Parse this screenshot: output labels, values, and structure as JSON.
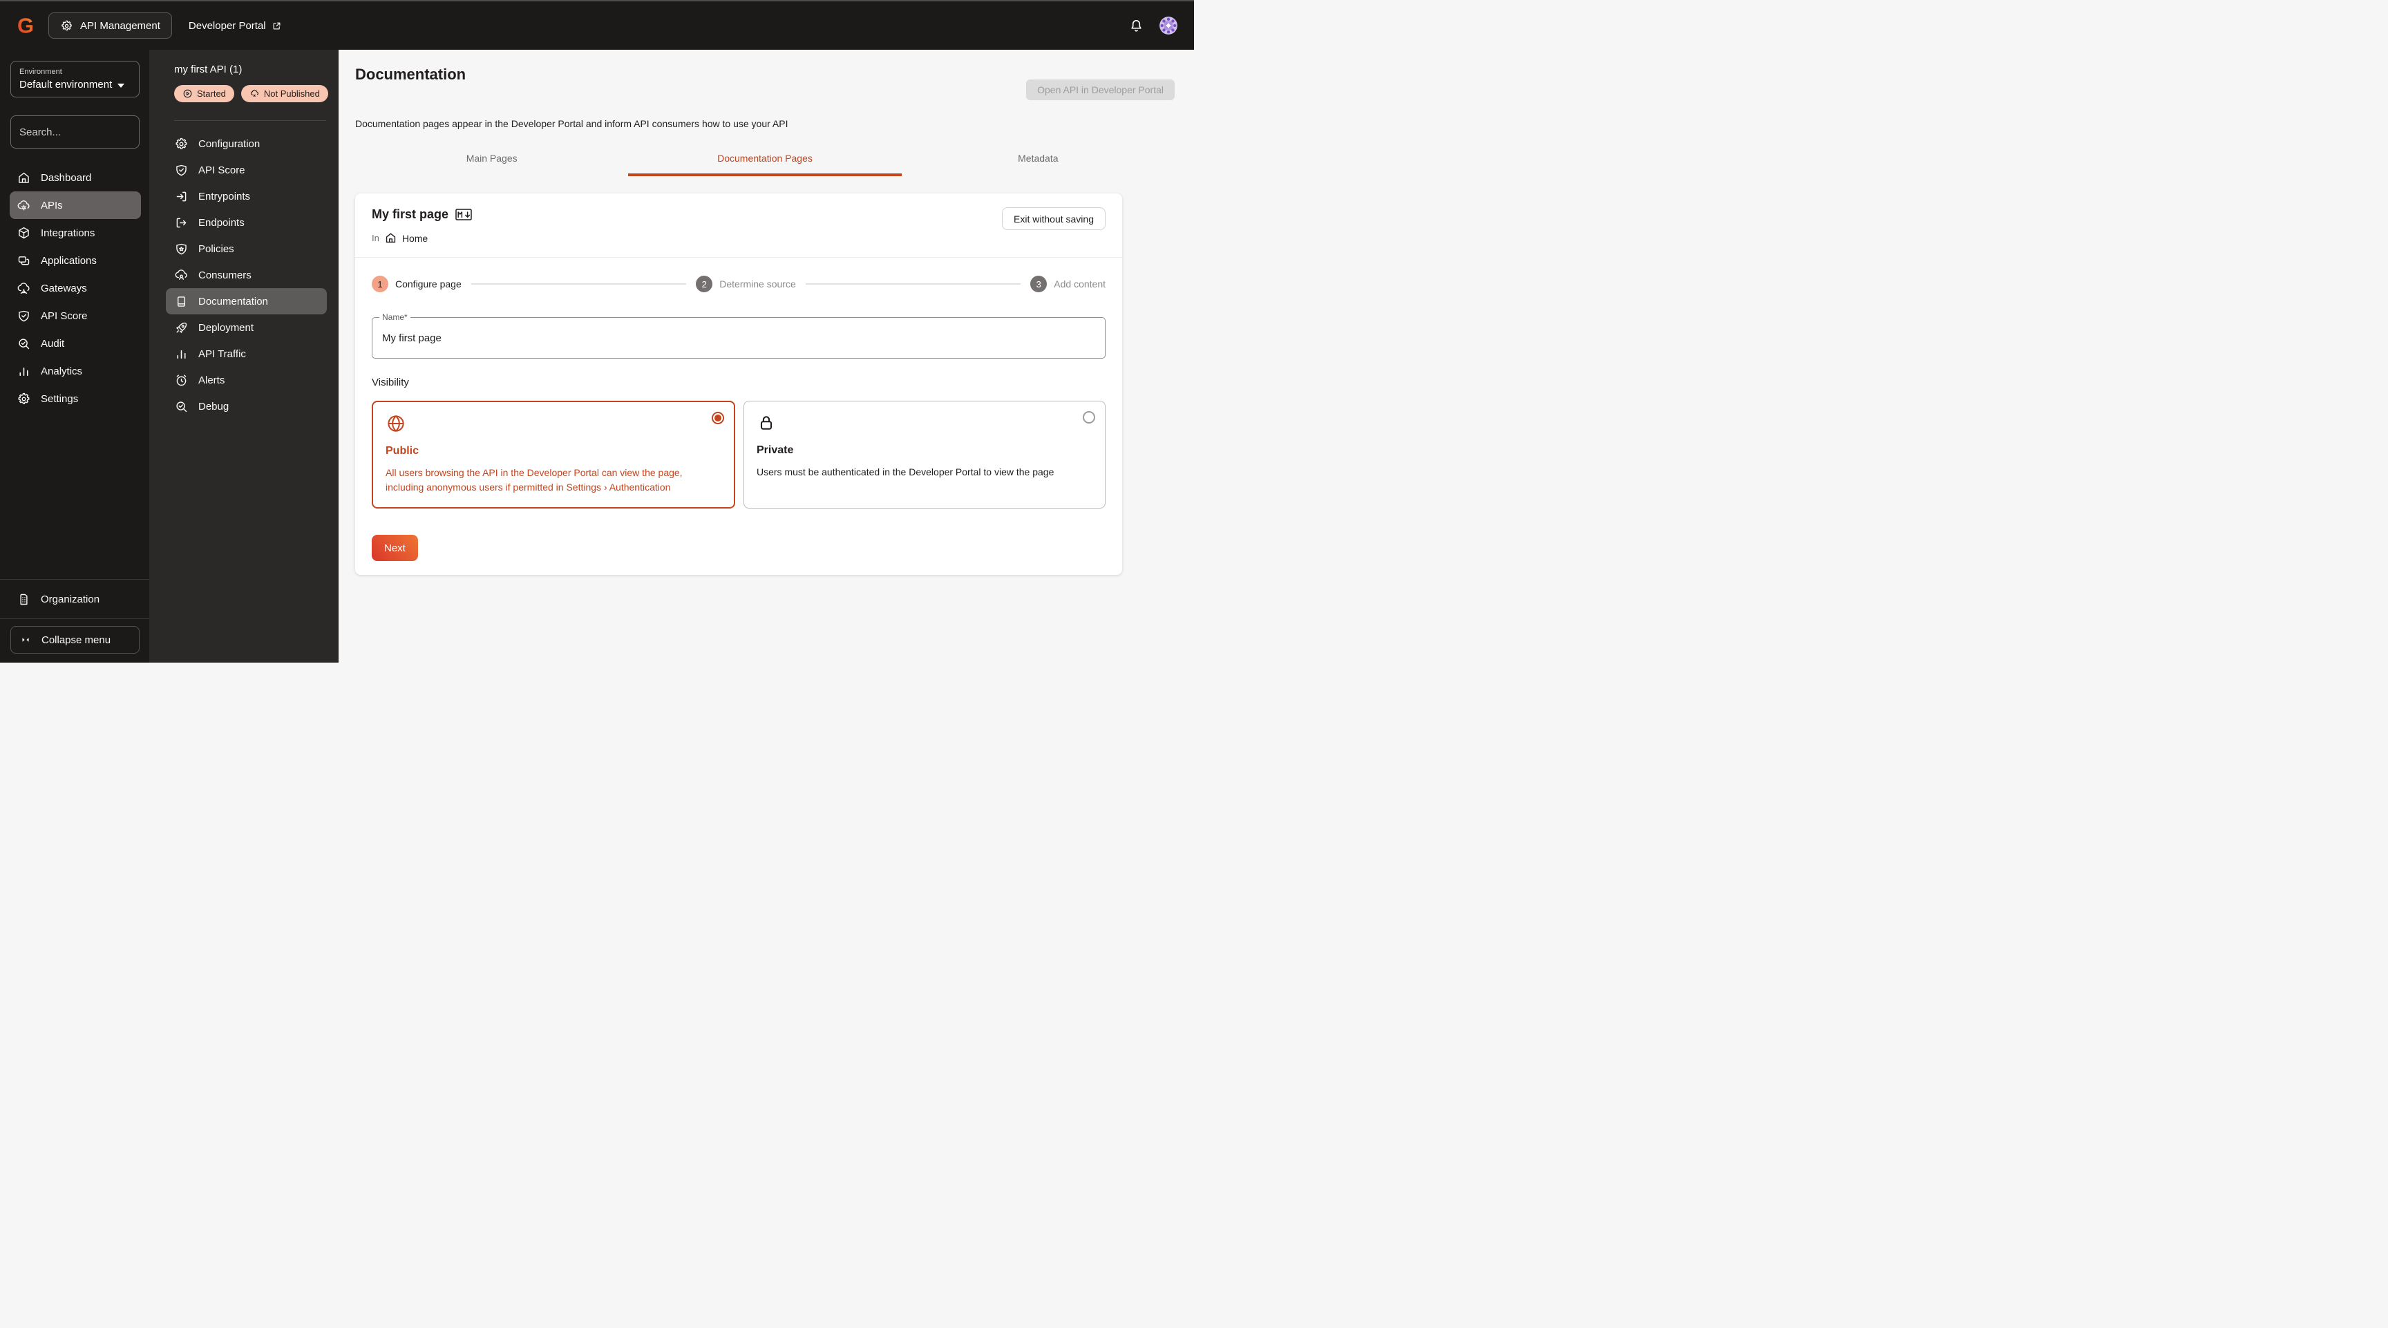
{
  "topbar": {
    "app_switcher": "API Management",
    "portal_link": "Developer Portal"
  },
  "sidebar": {
    "environment_label": "Environment",
    "environment_value": "Default environment",
    "search_placeholder": "Search...",
    "items": [
      {
        "label": "Dashboard",
        "icon": "home-icon"
      },
      {
        "label": "APIs",
        "icon": "cloud-gear-icon",
        "selected": true
      },
      {
        "label": "Integrations",
        "icon": "cube-icon"
      },
      {
        "label": "Applications",
        "icon": "cards-icon"
      },
      {
        "label": "Gateways",
        "icon": "cloud-node-icon"
      },
      {
        "label": "API Score",
        "icon": "shield-check-icon"
      },
      {
        "label": "Audit",
        "icon": "magnifier-check-icon"
      },
      {
        "label": "Analytics",
        "icon": "bar-chart-icon"
      },
      {
        "label": "Settings",
        "icon": "gear-icon"
      }
    ],
    "organization_label": "Organization",
    "collapse_label": "Collapse menu"
  },
  "api_menu": {
    "title": "my first API (1)",
    "badges": [
      {
        "label": "Started",
        "icon": "play-circle-icon"
      },
      {
        "label": "Not Published",
        "icon": "cloud-x-icon"
      }
    ],
    "items": [
      {
        "label": "Configuration",
        "icon": "gear-icon"
      },
      {
        "label": "API Score",
        "icon": "shield-check-icon"
      },
      {
        "label": "Entrypoints",
        "icon": "sign-in-icon"
      },
      {
        "label": "Endpoints",
        "icon": "sign-out-icon"
      },
      {
        "label": "Policies",
        "icon": "shield-star-icon"
      },
      {
        "label": "Consumers",
        "icon": "cloud-person-icon"
      },
      {
        "label": "Documentation",
        "icon": "book-icon",
        "selected": true
      },
      {
        "label": "Deployment",
        "icon": "rocket-icon"
      },
      {
        "label": "API Traffic",
        "icon": "bar-chart-icon"
      },
      {
        "label": "Alerts",
        "icon": "alarm-clock-icon"
      },
      {
        "label": "Debug",
        "icon": "magnifier-check-icon"
      }
    ]
  },
  "main": {
    "title": "Documentation",
    "description": "Documentation pages appear in the Developer Portal and inform API consumers how to use your API",
    "open_api_button": "Open API in Developer Portal",
    "tabs": [
      {
        "label": "Main Pages"
      },
      {
        "label": "Documentation Pages",
        "active": true
      },
      {
        "label": "Metadata"
      }
    ],
    "editor": {
      "page_title": "My first page",
      "format_icon": "markdown-icon",
      "location_prefix": "In",
      "location": "Home",
      "exit_button": "Exit without saving",
      "steps": [
        {
          "number": "1",
          "label": "Configure page",
          "state": "active"
        },
        {
          "number": "2",
          "label": "Determine source",
          "state": "inactive"
        },
        {
          "number": "3",
          "label": "Add content",
          "state": "inactive"
        }
      ],
      "name_field": {
        "label": "Name*",
        "value": "My first page"
      },
      "visibility_label": "Visibility",
      "options": [
        {
          "title": "Public",
          "description": "All users browsing the API in the Developer Portal can view the page, including anonymous users if permitted in Settings › Authentication",
          "icon": "globe-icon",
          "selected": true
        },
        {
          "title": "Private",
          "description": "Users must be authenticated in the Developer Portal to view the page",
          "icon": "lock-icon",
          "selected": false
        }
      ],
      "next_button": "Next"
    }
  },
  "colors": {
    "accent": "#c4441c",
    "badge_bg": "#f7c5b0",
    "step_active_bg": "#f2a287",
    "topbar_bg": "#1c1919",
    "sidebar2_bg": "#2b2828",
    "next_gradient_start": "#d9372a",
    "next_gradient_end": "#ee7434"
  }
}
